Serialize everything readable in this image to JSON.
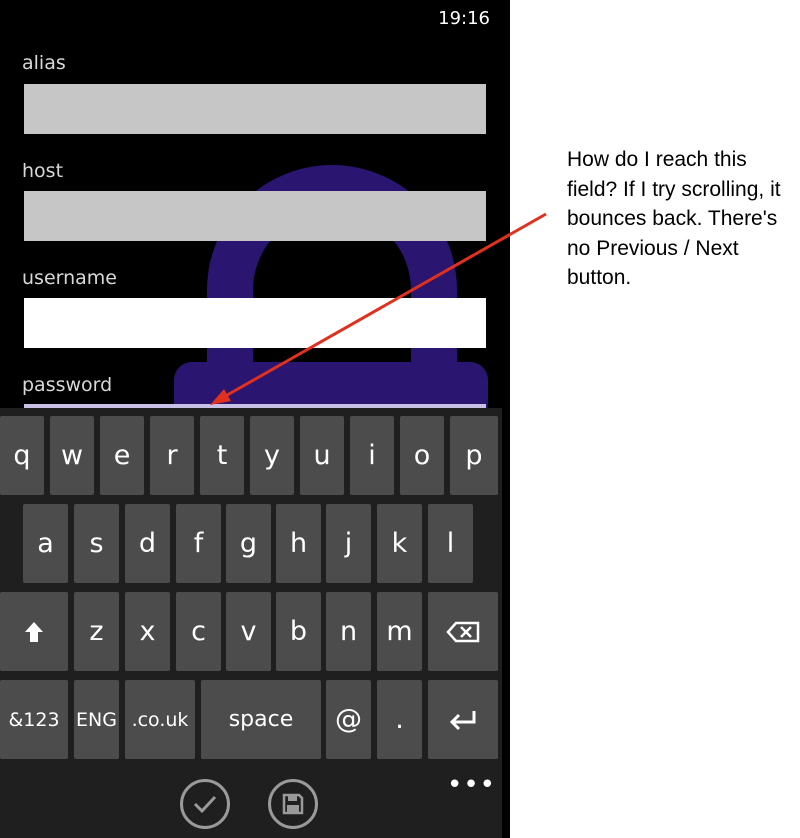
{
  "status_bar": {
    "time": "19:16"
  },
  "form": {
    "fields": [
      {
        "label": "alias"
      },
      {
        "label": "host"
      },
      {
        "label": "username"
      },
      {
        "label": "password"
      }
    ]
  },
  "keyboard": {
    "row1": [
      "q",
      "w",
      "e",
      "r",
      "t",
      "y",
      "u",
      "i",
      "o",
      "p"
    ],
    "row2": [
      "a",
      "s",
      "d",
      "f",
      "g",
      "h",
      "j",
      "k",
      "l"
    ],
    "row3": [
      "z",
      "x",
      "c",
      "v",
      "b",
      "n",
      "m"
    ],
    "row4": {
      "symbols": "&123",
      "lang": "ENG",
      "domain": ".co.uk",
      "space": "space",
      "at": "@",
      "dot": "."
    }
  },
  "app_bar": {
    "more": "•••"
  },
  "annotation": {
    "text": "How do I reach this field? If I try scrolling, it bounces back. There's no Previous / Next button."
  },
  "colors": {
    "background": "#000000",
    "field": "#c6c6c6",
    "focused_field": "#ffffff",
    "key": "#4c4c4c",
    "accent": "#2a1570",
    "arrow": "#e0301e"
  },
  "icons": [
    "shift-icon",
    "backspace-icon",
    "enter-icon",
    "check-icon",
    "save-icon",
    "lock-background-icon"
  ]
}
